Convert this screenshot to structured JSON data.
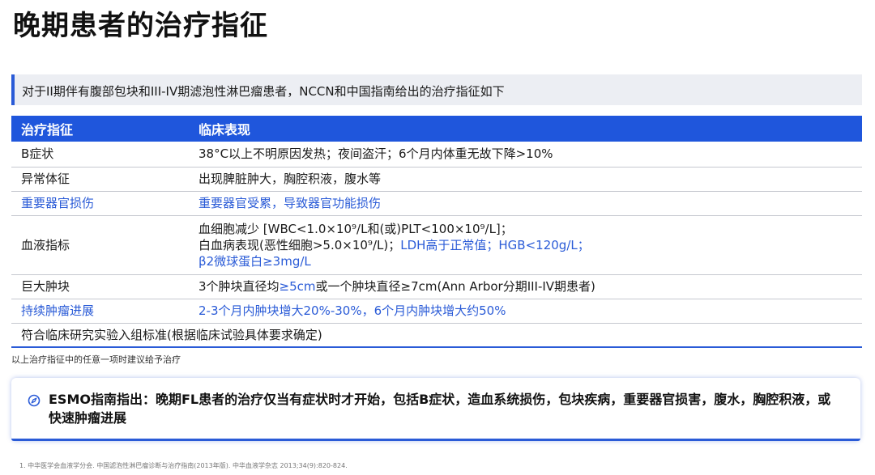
{
  "title": "晚期患者的治疗指征",
  "intro": "对于II期伴有腹部包块和III-IV期滤泡性淋巴瘤患者，NCCN和中国指南给出的治疗指征如下",
  "table": {
    "headers": [
      "治疗指征",
      "临床表现"
    ],
    "rows": [
      {
        "label": "B症状",
        "desc": "38°C以上不明原因发热；夜间盗汗；6个月内体重无故下降>10%"
      },
      {
        "label": "异常体征",
        "desc": "出现脾脏肿大，胸腔积液，腹水等"
      },
      {
        "label": "重要器官损伤",
        "desc": "重要器官受累，导致器官功能损伤"
      },
      {
        "label": "血液指标",
        "line1": "血细胞减少 [WBC<1.0×10⁹/L和(或)PLT<100×10⁹/L]；",
        "line2a": "白血病表现(恶性细胞>5.0×10⁹/L)；",
        "line2b": "LDH高于正常值；HGB<120g/L；",
        "line3": "β2微球蛋白≥3mg/L"
      },
      {
        "label": "巨大肿块",
        "desc_a": "3个肿块直径均",
        "desc_b": "≥5cm",
        "desc_c": "或一个肿块直径≥7cm(Ann Arbor分期III-IV期患者)"
      },
      {
        "label": "持续肿瘤进展",
        "desc": "2-3个月内肿块增大20%-30%，6个月内肿块增大约50%"
      },
      {
        "label": "符合临床研究实验入组标准(根据临床试验具体要求确定)"
      }
    ]
  },
  "footnote": "以上治疗指征中的任意一项时建议给予治疗",
  "esmo": {
    "icon": "compass-icon",
    "text": "ESMO指南指出：晚期FL患者的治疗仅当有症状时才开始，包括B症状，造血系统损伤，包块疾病，重要器官损害，腹水，胸腔积液，或快速肿瘤进展"
  },
  "reference": "1.    中华医学会血液学分会. 中国滤泡性淋巴瘤诊断与治疗指南(2013年版). 中华血液学杂志 2013;34(9):820-824.",
  "colors": {
    "accent": "#1f56dc",
    "link_blue": "#2a5bd7",
    "intro_bg": "#eceef3"
  }
}
